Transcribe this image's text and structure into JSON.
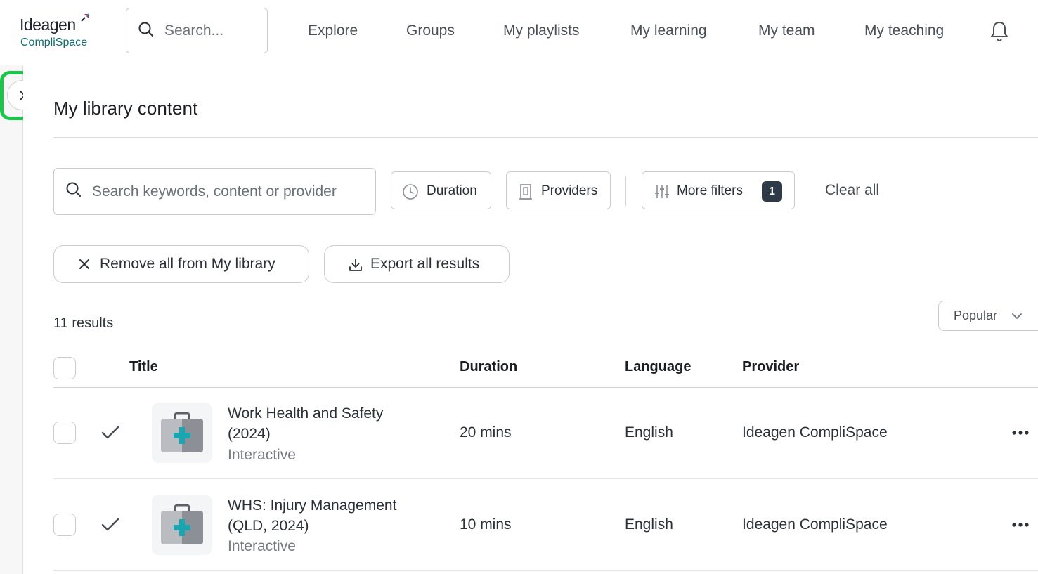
{
  "header": {
    "logo_primary": "Ideagen",
    "logo_secondary": "CompliSpace",
    "search_placeholder": "Search...",
    "nav": [
      "Explore",
      "Groups",
      "My playlists",
      "My learning",
      "My team",
      "My teaching"
    ]
  },
  "page": {
    "title": "My library content"
  },
  "filters": {
    "search_placeholder": "Search keywords, content or provider",
    "duration_label": "Duration",
    "providers_label": "Providers",
    "more_filters_label": "More filters",
    "more_filters_count": "1",
    "clear_all_label": "Clear all"
  },
  "actions": {
    "remove_all_label": "Remove all from My library",
    "export_label": "Export all results"
  },
  "results": {
    "count_label": "11 results",
    "sort_label": "Popular"
  },
  "table": {
    "columns": [
      "Title",
      "Duration",
      "Language",
      "Provider"
    ],
    "rows": [
      {
        "title_line1": "Work Health and Safety",
        "title_line2": "(2024)",
        "type": "Interactive",
        "duration": "20 mins",
        "language": "English",
        "provider": "Ideagen CompliSpace"
      },
      {
        "title_line1": "WHS: Injury Management",
        "title_line2": "(QLD, 2024)",
        "type": "Interactive",
        "duration": "10 mins",
        "language": "English",
        "provider": "Ideagen CompliSpace"
      }
    ]
  },
  "colors": {
    "accent_highlight": "#1dc44a",
    "badge_bg": "#2f3a48",
    "brand_teal": "#0a6e73"
  },
  "icons": {
    "sidebar_toggle": "chevron-right-icon",
    "search": "search-icon",
    "bell": "bell-icon",
    "duration": "clock-icon",
    "providers": "building-icon",
    "more_filters": "sliders-icon",
    "remove": "close-icon",
    "export": "download-icon",
    "sort": "chevron-down-icon",
    "selected": "checkmark-icon",
    "row_menu": "more-horizontal-icon",
    "thumbnail": "first-aid-kit-icon"
  }
}
